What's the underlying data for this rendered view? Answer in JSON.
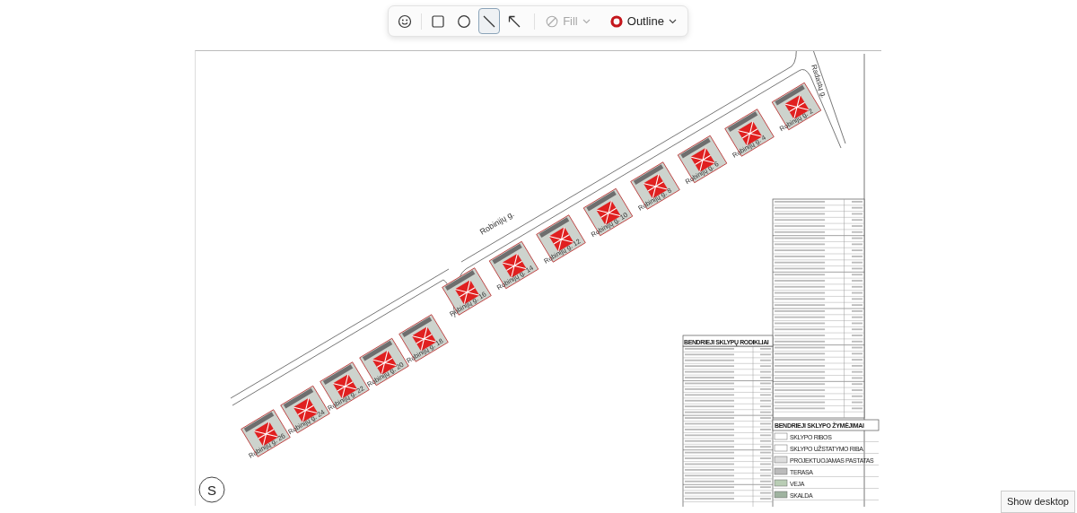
{
  "toolbar": {
    "tools": [
      {
        "kind": "emoji",
        "selected": false
      },
      {
        "kind": "rectangle",
        "selected": false
      },
      {
        "kind": "ellipse",
        "selected": false
      },
      {
        "kind": "line",
        "selected": true
      },
      {
        "kind": "arrow",
        "selected": false
      }
    ],
    "fill": {
      "label": "Fill",
      "disabled": true
    },
    "outline": {
      "label": "Outline",
      "disabled": false
    }
  },
  "plan": {
    "roads": [
      "Robinijų g.",
      "Radastų g."
    ],
    "west_block": [
      "Robinijų g. 26",
      "Robinijų g. 24",
      "Robinijų g. 22",
      "Robinijų g. 20",
      "Robinijų g. 18"
    ],
    "east_block": [
      "Robinijų g. 16",
      "Robinijų g. 14",
      "Robinijų g. 12",
      "Robinijų g. 10",
      "Robinijų g. 8",
      "Robinijų g. 6",
      "Robinijų g. 4",
      "Robinijų g. 2"
    ],
    "north_sign": "S",
    "indicators_title": "BENDRIEJI SKLYPŲ RODIKLIAI",
    "legend_title": "BENDRIEJI SKLYPO ŽYMĖJIMAI",
    "legend": [
      "SKLYPO RIBOS",
      "SKLYPO UŽSTATYMO RIBA",
      "PROJEKTUOJAMAS PASTATAS",
      "TERASA",
      "VEJA",
      "SKALDA"
    ]
  },
  "tooltip": "Show desktop"
}
